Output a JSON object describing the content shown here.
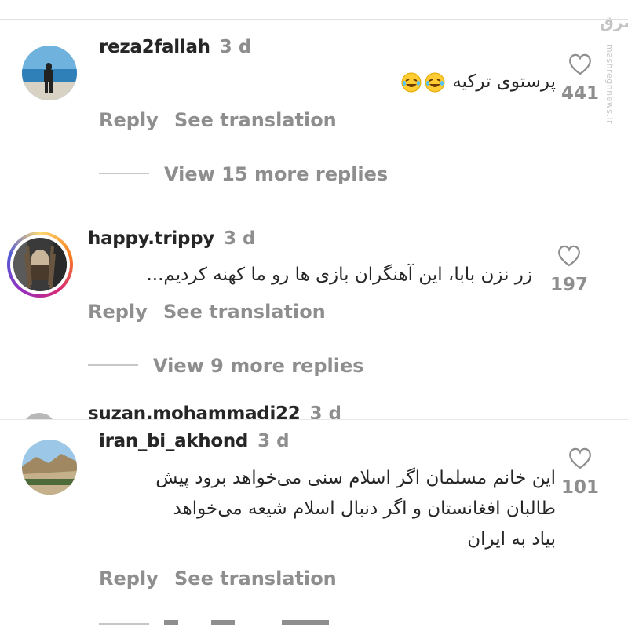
{
  "watermark": {
    "logo": "مشرق",
    "site": "mashreghnews.ir"
  },
  "comments": [
    {
      "username": "reza2fallah",
      "time": "3 d",
      "text": "پرستوی ترکیه",
      "likes": "441",
      "reply": "Reply",
      "translate": "See translation",
      "more_replies": "View 15 more replies"
    },
    {
      "username": "happy.trippy",
      "time": "3 d",
      "text": "زر نزن بابا، این آهنگران بازی ها رو ما کهنه کردیم...",
      "likes": "197",
      "reply": "Reply",
      "translate": "See translation",
      "more_replies": "View 9 more replies"
    },
    {
      "username": "suzan.mohammadi22",
      "time": "3 d"
    },
    {
      "username": "iran_bi_akhond",
      "time": "3 d",
      "lines": [
        "این خانم مسلمان اگر اسلام سنی می‌خواهد برود پیش",
        "طالبان افغانستان و اگر دنبال اسلام شیعه می‌خواهد",
        "بیاد به ایران"
      ],
      "likes": "101",
      "reply": "Reply",
      "translate": "See translation"
    }
  ]
}
